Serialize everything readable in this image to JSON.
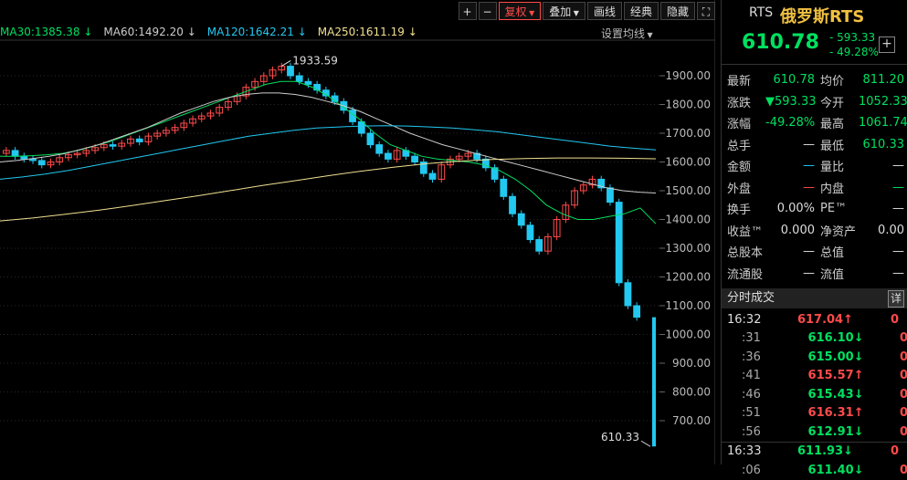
{
  "toolbar": {
    "plus_label": "+",
    "minus_label": "−",
    "fq_label": "复权",
    "overlay_label": "叠加",
    "draw_label": "画线",
    "classic_label": "经典",
    "hide_label": "隐藏"
  },
  "ma_legend": [
    {
      "label": "MA30:1385.38",
      "arrow": "↓",
      "color": "#00e060"
    },
    {
      "label": "MA60:1492.20",
      "arrow": "↓",
      "color": "#cccccc"
    },
    {
      "label": "MA120:1642.21",
      "arrow": "↓",
      "color": "#22c8f0"
    },
    {
      "label": "MA250:1611.19",
      "arrow": "↓",
      "color": "#f0e090"
    }
  ],
  "ma_settings_label": "设置均线",
  "chart_data": {
    "type": "candlestick",
    "y_ticks": [
      700,
      800,
      900,
      1000,
      1100,
      1200,
      1300,
      1400,
      1500,
      1600,
      1700,
      1800,
      1900
    ],
    "ylim": [
      615,
      1960
    ],
    "annotations": [
      {
        "text": "1933.59",
        "value": 1933.59
      },
      {
        "text": "610.33",
        "value": 610.33
      }
    ],
    "closes": [
      1640,
      1620,
      1610,
      1605,
      1590,
      1600,
      1615,
      1625,
      1630,
      1640,
      1650,
      1660,
      1655,
      1665,
      1680,
      1670,
      1690,
      1700,
      1710,
      1720,
      1735,
      1750,
      1760,
      1770,
      1790,
      1810,
      1830,
      1860,
      1880,
      1900,
      1920,
      1933,
      1900,
      1880,
      1870,
      1850,
      1830,
      1810,
      1780,
      1740,
      1700,
      1660,
      1630,
      1610,
      1640,
      1620,
      1600,
      1560,
      1540,
      1590,
      1610,
      1620,
      1630,
      1610,
      1580,
      1540,
      1480,
      1420,
      1380,
      1330,
      1290,
      1340,
      1400,
      1450,
      1500,
      1520,
      1540,
      1510,
      1460,
      1180,
      1100,
      1060
    ],
    "ma_lines": [
      {
        "name": "MA30",
        "color": "#00e060",
        "values": [
          1620,
          1620,
          1622,
          1625,
          1630,
          1640,
          1655,
          1670,
          1690,
          1710,
          1730,
          1750,
          1770,
          1790,
          1810,
          1830,
          1850,
          1870,
          1880,
          1880,
          1860,
          1830,
          1790,
          1750,
          1700,
          1660,
          1640,
          1620,
          1610,
          1605,
          1600,
          1590,
          1570,
          1540,
          1500,
          1450,
          1420,
          1400,
          1400,
          1410,
          1420,
          1440,
          1385
        ]
      },
      {
        "name": "MA60",
        "color": "#cccccc",
        "values": [
          1600,
          1605,
          1612,
          1620,
          1630,
          1645,
          1660,
          1680,
          1700,
          1720,
          1745,
          1770,
          1790,
          1810,
          1825,
          1835,
          1840,
          1840,
          1835,
          1825,
          1810,
          1795,
          1775,
          1750,
          1725,
          1700,
          1680,
          1660,
          1645,
          1630,
          1615,
          1600,
          1585,
          1570,
          1555,
          1540,
          1525,
          1510,
          1500,
          1495,
          1492
        ]
      },
      {
        "name": "MA120",
        "color": "#22c8f0",
        "values": [
          1540,
          1548,
          1558,
          1570,
          1585,
          1600,
          1615,
          1630,
          1645,
          1660,
          1675,
          1690,
          1700,
          1710,
          1718,
          1722,
          1725,
          1726,
          1725,
          1722,
          1718,
          1712,
          1705,
          1695,
          1685,
          1675,
          1665,
          1655,
          1648,
          1642
        ]
      },
      {
        "name": "MA250",
        "color": "#f0e090",
        "values": [
          1395,
          1405,
          1418,
          1432,
          1448,
          1465,
          1482,
          1500,
          1518,
          1535,
          1552,
          1568,
          1582,
          1594,
          1603,
          1609,
          1612,
          1614,
          1614,
          1613,
          1611
        ]
      }
    ],
    "last_bar": {
      "open": 1060,
      "close": 610.33
    }
  },
  "quote": {
    "code": "RTS",
    "name": "俄罗斯RTS",
    "price": "610.78",
    "change": "- 593.33",
    "change_pct": "- 49.28%",
    "add_label": "+",
    "rows": [
      {
        "k1": "最新",
        "v1": "610.78",
        "c1": "#00e060",
        "k2": "均价",
        "v2": "811.20",
        "c2": "#00e060"
      },
      {
        "k1": "涨跌",
        "v1": "▼593.33",
        "c1": "#00e060",
        "k2": "今开",
        "v2": "1052.33",
        "c2": "#00e060"
      },
      {
        "k1": "涨幅",
        "v1": "-49.28%",
        "c1": "#00e060",
        "k2": "最高",
        "v2": "1061.74",
        "c2": "#00e060"
      },
      {
        "k1": "总手",
        "v1": "—",
        "c1": "#ddd",
        "k2": "最低",
        "v2": "610.33",
        "c2": "#00e060"
      },
      {
        "k1": "金额",
        "v1": "—",
        "c1": "#22c8f0",
        "k2": "量比",
        "v2": "—",
        "c2": "#ddd"
      },
      {
        "k1": "外盘",
        "v1": "—",
        "c1": "#ff4b4b",
        "k2": "内盘",
        "v2": "—",
        "c2": "#00e060"
      },
      {
        "k1": "换手",
        "v1": "0.00%",
        "c1": "#ddd",
        "k2": "PE™",
        "v2": "—",
        "c2": "#ddd"
      },
      {
        "k1": "收益™",
        "v1": "0.000",
        "c1": "#ddd",
        "k2": "净资产",
        "v2": "0.00",
        "c2": "#ddd"
      },
      {
        "k1": "总股本",
        "v1": "—",
        "c1": "#ddd",
        "k2": "总值",
        "v2": "—",
        "c2": "#ddd"
      },
      {
        "k1": "流通股",
        "v1": "—",
        "c1": "#ddd",
        "k2": "流值",
        "v2": "—",
        "c2": "#ddd"
      }
    ]
  },
  "ticks": {
    "header": "分时成交",
    "detail_label": "详",
    "rows": [
      {
        "time": "16:32",
        "price": "617.04",
        "dir": "up",
        "vol": "0"
      },
      {
        "time": ":31",
        "price": "616.10",
        "dir": "dn",
        "vol": "0"
      },
      {
        "time": ":36",
        "price": "615.00",
        "dir": "dn",
        "vol": "0"
      },
      {
        "time": ":41",
        "price": "615.57",
        "dir": "up",
        "vol": "0"
      },
      {
        "time": ":46",
        "price": "615.43",
        "dir": "dn",
        "vol": "0"
      },
      {
        "time": ":51",
        "price": "616.31",
        "dir": "up",
        "vol": "0"
      },
      {
        "time": ":56",
        "price": "612.91",
        "dir": "dn",
        "vol": "0"
      },
      {
        "time": "16:33",
        "price": "611.93",
        "dir": "dn",
        "vol": "0"
      },
      {
        "time": ":06",
        "price": "611.40",
        "dir": "dn",
        "vol": "0"
      }
    ]
  }
}
